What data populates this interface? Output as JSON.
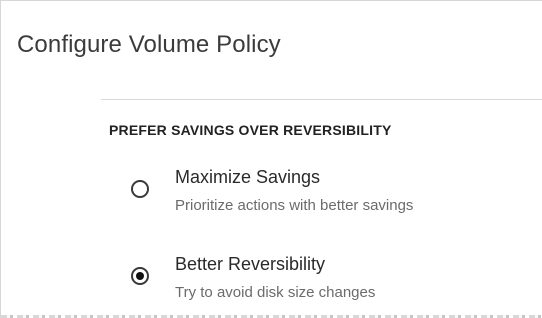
{
  "dialog": {
    "title": "Configure Volume Policy"
  },
  "section": {
    "header": "PREFER SAVINGS OVER REVERSIBILITY",
    "options": [
      {
        "label": "Maximize Savings",
        "description": "Prioritize actions with better savings",
        "selected": false
      },
      {
        "label": "Better Reversibility",
        "description": "Try to avoid disk size changes",
        "selected": true
      }
    ]
  }
}
